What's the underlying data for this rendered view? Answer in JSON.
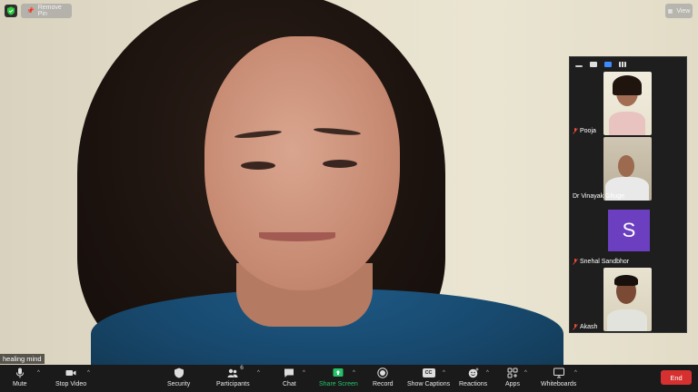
{
  "top_bar": {
    "remove_pin_label": "Remove Pin",
    "view_label": "View",
    "security_shield_color": "#2ecc40"
  },
  "self_view": {
    "name_label": "healing mind"
  },
  "gallery_panel": {
    "participants": [
      {
        "name": "Pooja",
        "muted": true
      },
      {
        "name": "Dr Vinayak Ghuge",
        "muted": false
      },
      {
        "name": "Snehal Sandbhor",
        "muted": true,
        "avatar_letter": "S",
        "avatar_color": "#6b3fc0"
      },
      {
        "name": "Akash",
        "muted": true
      }
    ]
  },
  "toolbar": {
    "mute_label": "Mute",
    "stop_video_label": "Stop Video",
    "security_label": "Security",
    "participants_label": "Participants",
    "participants_count": "6",
    "chat_label": "Chat",
    "share_screen_label": "Share Screen",
    "record_label": "Record",
    "show_captions_label": "Show Captions",
    "cc_badge": "CC",
    "reactions_label": "Reactions",
    "apps_label": "Apps",
    "whiteboards_label": "Whiteboards",
    "end_label": "End",
    "share_color": "#25c26a",
    "end_color": "#d63030"
  }
}
